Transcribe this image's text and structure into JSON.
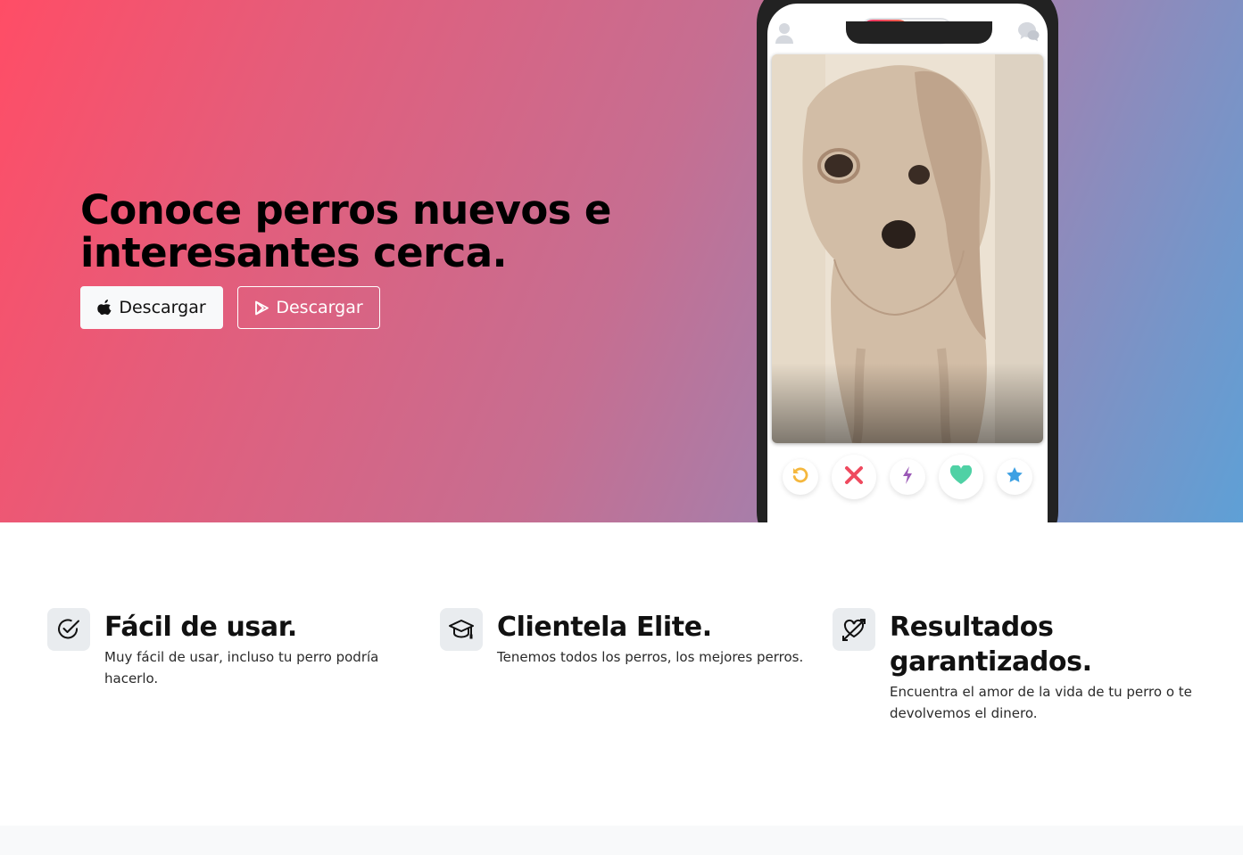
{
  "hero": {
    "title": "Conoce perros nuevos e interesantes cerca.",
    "buttons": [
      {
        "label": "Descargar",
        "icon": "apple-icon"
      },
      {
        "label": "Descargar",
        "icon": "google-play-icon"
      }
    ],
    "gradient_colors": [
      "#ff4d66",
      "#c66e91",
      "#5ea0d6"
    ]
  },
  "phone": {
    "topbar_icons": [
      "profile-icon",
      "flame-icon",
      "group-icon",
      "chat-icon"
    ],
    "photo": "dog-photo",
    "actions": [
      {
        "name": "rewind",
        "icon": "rewind-icon",
        "color": "#f5b73d"
      },
      {
        "name": "nope",
        "icon": "close-icon",
        "color": "#ef4a5f"
      },
      {
        "name": "boost",
        "icon": "lightning-icon",
        "color": "#9b59b6"
      },
      {
        "name": "like",
        "icon": "heart-icon",
        "color": "#4fd1a5"
      },
      {
        "name": "super-like",
        "icon": "star-icon",
        "color": "#3da0e3"
      }
    ]
  },
  "features": [
    {
      "icon": "check-circle-icon",
      "title": "Fácil de usar.",
      "text": "Muy fácil de usar, incluso tu perro podría hacerlo."
    },
    {
      "icon": "graduation-cap-icon",
      "title": "Clientela Elite.",
      "text": "Tenemos todos los perros, los mejores perros."
    },
    {
      "icon": "heart-arrow-icon",
      "title": "Resultados garantizados.",
      "text": "Encuentra el amor de la vida de tu perro o te devolvemos el dinero."
    }
  ]
}
